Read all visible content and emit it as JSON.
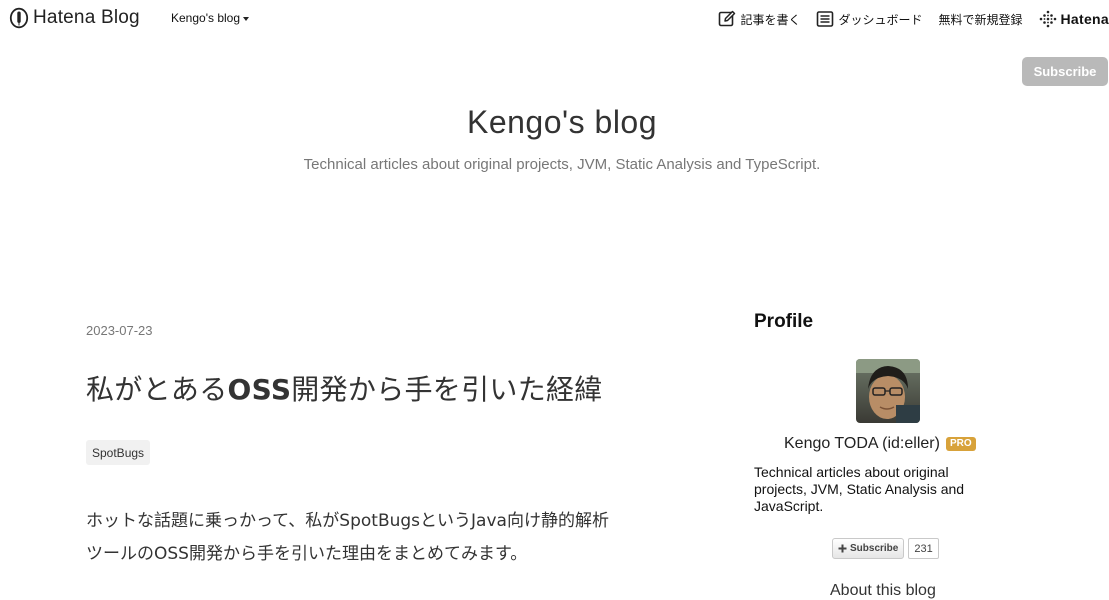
{
  "global_header": {
    "logo_text": "Hatena Blog",
    "blog_switcher": "Kengo's blog",
    "write_article": "記事を書く",
    "dashboard": "ダッシュボード",
    "signup": "無料で新規登録",
    "hatena": "Hatena"
  },
  "subscribe_button": "Subscribe",
  "blog": {
    "title": "Kengo's blog",
    "description": "Technical articles about original projects, JVM, Static Analysis and TypeScript."
  },
  "entry": {
    "date": "2023-07-23",
    "title_part1": "私がとある",
    "title_part2": "OSS",
    "title_part3": "開発から手を引いた経緯",
    "category": "SpotBugs",
    "body_line1": "ホットな話題に乗っかって、私がSpotBugsというJava向け静的解析",
    "body_line2": "ツールのOSS開発から手を引いた理由をまとめてみます。"
  },
  "sidebar": {
    "profile_heading": "Profile",
    "profile_name": "Kengo TODA (id:eller)",
    "pro_badge": "PRO",
    "profile_description": "Technical articles about original projects, JVM, Static Analysis and JavaScript.",
    "subscribe_label": "Subscribe",
    "subscriber_count": "231",
    "about_link": "About this blog"
  },
  "colors": {
    "subscribe_bg": "#b9b9b9",
    "pro_badge": "#d8a23a",
    "text_main": "#333333",
    "text_muted": "#777777"
  }
}
